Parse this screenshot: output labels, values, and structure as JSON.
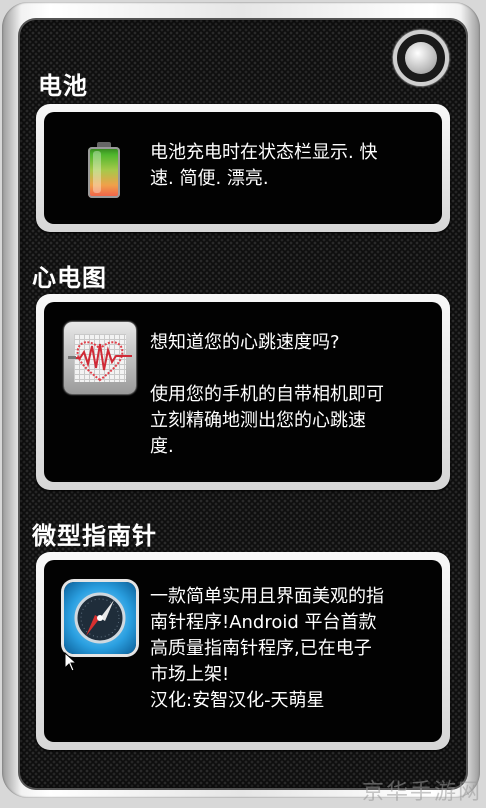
{
  "sections": [
    {
      "title": "电池",
      "icon": "battery-icon",
      "text": "电池充电时在状态栏显示. 快\n速. 简便. 漂亮."
    },
    {
      "title": "心电图",
      "icon": "heart-monitor-icon",
      "text": "想知道您的心跳速度吗?\n\n使用您的手机的自带相机即可\n立刻精确地测出您的心跳速\n度."
    },
    {
      "title": "微型指南针",
      "icon": "compass-icon",
      "text": "一款简单实用且界面美观的指\n南针程序!Android 平台首款\n高质量指南针程序,已在电子\n市场上架!\n汉化:安智汉化-天萌星"
    }
  ],
  "watermark": "京华手游网",
  "colors": {
    "background": "#0e0e0e",
    "card_border": "#e6e6e6",
    "text": "#ffffff"
  }
}
